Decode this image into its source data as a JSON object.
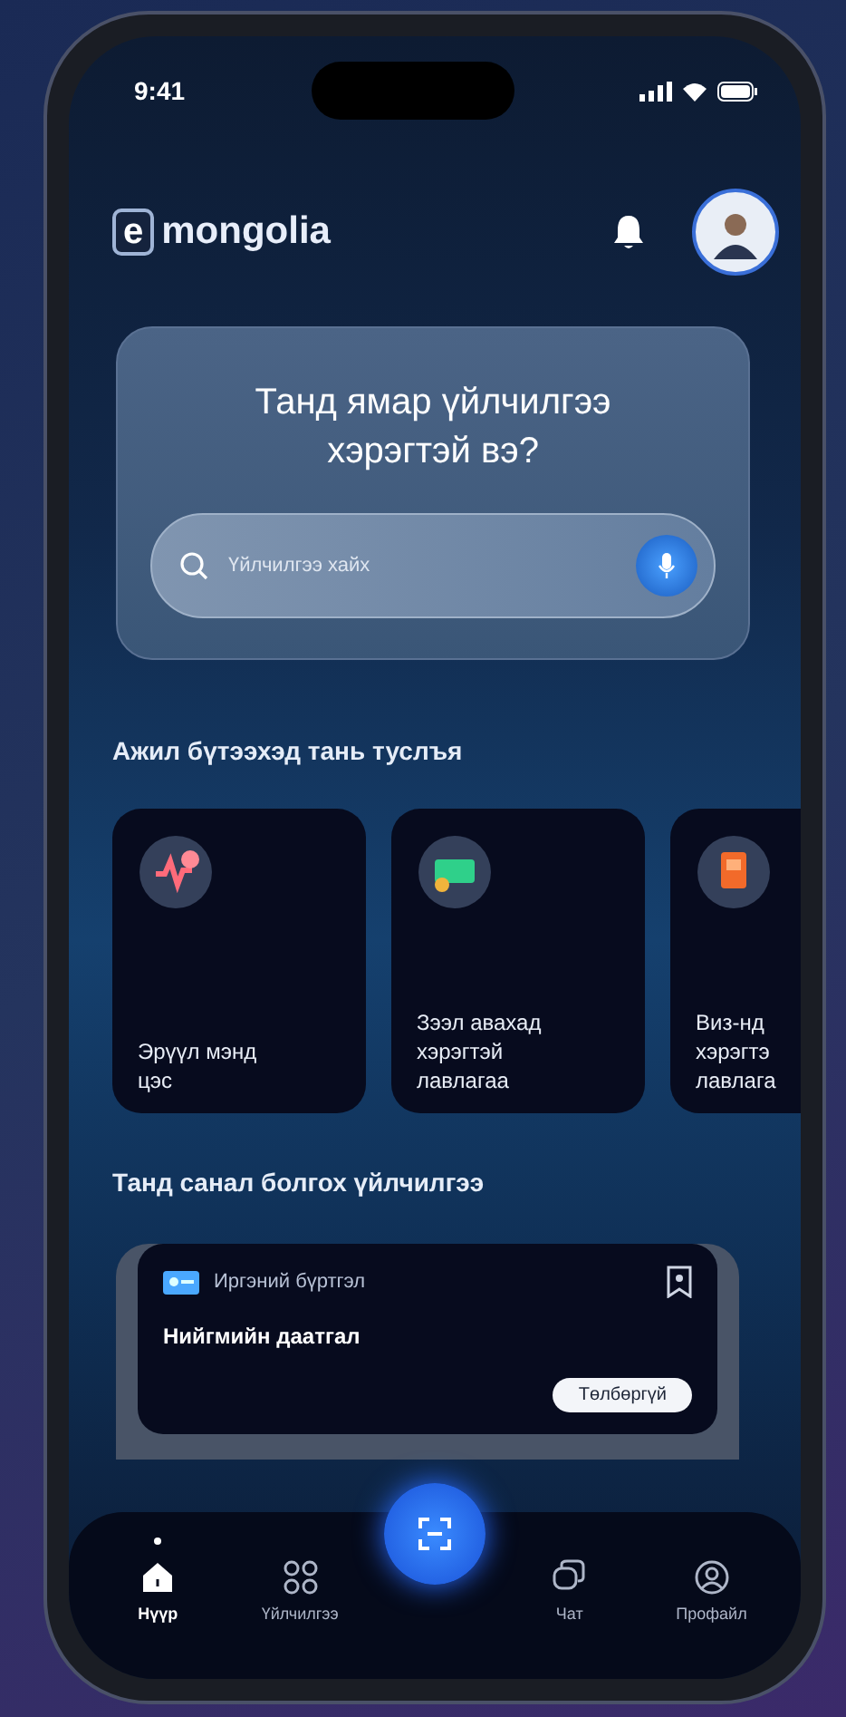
{
  "status_bar": {
    "time": "9:41"
  },
  "header": {
    "logo_letter": "e",
    "logo_text": "mongolia"
  },
  "hero": {
    "title": "Танд ямар үйлчилгээ хэрэгтэй вэ?",
    "search": {
      "placeholder": "Үйлчилгээ хайх"
    }
  },
  "help_section": {
    "title": "Ажил бүтээхэд тань туслъя",
    "cards": [
      {
        "label": "Эрүүл мэнд цэс",
        "kind": "health"
      },
      {
        "label": "Зээл авахад хэрэгтэй лавлагаа",
        "kind": "money"
      },
      {
        "label": "Виз-нд хэрэгтэ лавлага",
        "kind": "passport"
      }
    ]
  },
  "recommended": {
    "title": "Танд санал болгох үйлчилгээ",
    "card": {
      "category": "Иргэний бүртгэл",
      "title": "Нийгмийн даатгал",
      "badge": "Төлбөргүй"
    }
  },
  "nav": {
    "items": [
      {
        "label": "Нүүр",
        "kind": "home",
        "selected": true
      },
      {
        "label": "Үйлчилгээ",
        "kind": "grid",
        "selected": false
      },
      {
        "kind": "scan",
        "selected": false
      },
      {
        "label": "Чат",
        "kind": "chat",
        "selected": false
      },
      {
        "label": "Профайл",
        "kind": "profile",
        "selected": false
      }
    ]
  }
}
